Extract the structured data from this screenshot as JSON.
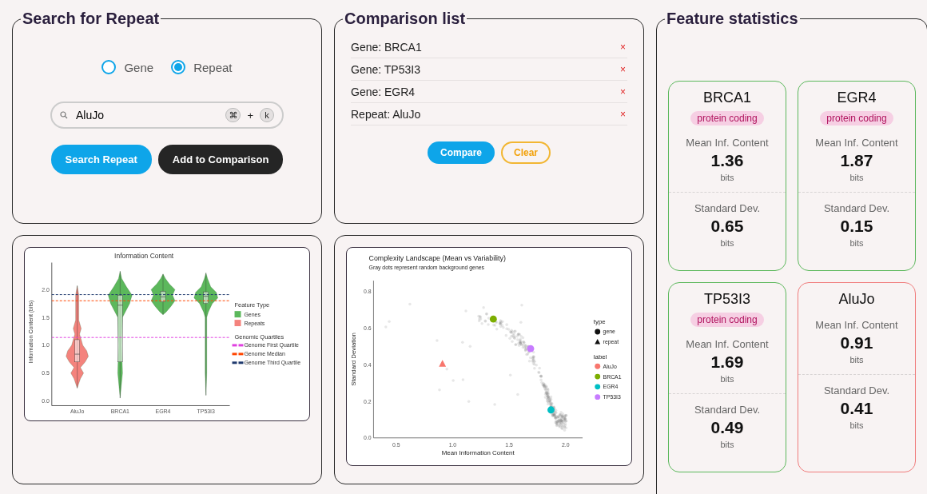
{
  "search_panel": {
    "title": "Search for Repeat",
    "modes": [
      {
        "label": "Gene",
        "selected": false
      },
      {
        "label": "Repeat",
        "selected": true
      }
    ],
    "search": {
      "value": "AluJo",
      "keys": [
        "⌘",
        "+",
        "k"
      ]
    },
    "buttons": [
      {
        "label": "Search Repeat",
        "kind": "primary"
      },
      {
        "label": "Add to Comparison",
        "kind": "dark"
      }
    ]
  },
  "comparison_panel": {
    "title": "Comparison list",
    "items": [
      {
        "label": "Gene: BRCA1",
        "remove": "×"
      },
      {
        "label": "Gene: TP53I3",
        "remove": "×"
      },
      {
        "label": "Gene: EGR4",
        "remove": "×"
      },
      {
        "label": "Repeat: AluJo",
        "remove": "×"
      }
    ],
    "buttons": [
      {
        "label": "Compare",
        "kind": "primary"
      },
      {
        "label": "Clear",
        "kind": "outline"
      }
    ]
  },
  "violin_chart": {
    "title": "Information Content",
    "ylabel": "Information Content (bits)",
    "yticks": [
      "2.0",
      "1.5",
      "1.0",
      "0.5",
      "0.0"
    ],
    "categories": [
      {
        "label": "AluJo",
        "color": "#f4837d"
      },
      {
        "label": "BRCA1",
        "color": "#5cb85c"
      },
      {
        "label": "EGR4",
        "color": "#5cb85c"
      },
      {
        "label": "TP53I3",
        "color": "#5cb85c"
      }
    ],
    "feature_title": "Feature Type",
    "features": [
      {
        "label": "Genes",
        "color": "#5cb85c"
      },
      {
        "label": "Repeats",
        "color": "#f4837d"
      }
    ],
    "quartile_title": "Genomic Quartiles",
    "quartiles": [
      {
        "label": "Genome First Quartile",
        "color": "#e040e0"
      },
      {
        "label": "Genome Median",
        "color": "#ff4500"
      },
      {
        "label": "Genome Third Quartile",
        "color": "#1f3a6e"
      }
    ]
  },
  "scatter_chart": {
    "chart_data": {
      "type": "scatter",
      "title": "Complexity Landscape (Mean vs Variability)",
      "annotations": [
        "Gray dots represent random background genes"
      ],
      "xlabel": "Mean Information Content",
      "ylabel": "Standard Deviation",
      "xlim": [
        0.3,
        2.15
      ],
      "ylim": [
        0,
        0.86
      ],
      "xticks": [
        {
          "value": 0.5,
          "label": "0.5"
        },
        {
          "value": 1,
          "label": "1.0"
        },
        {
          "value": 1.5,
          "label": "1.5"
        },
        {
          "value": 2,
          "label": "2.0"
        }
      ],
      "yticks": [
        {
          "value": 0,
          "label": "0.0"
        },
        {
          "value": 0.2,
          "label": "0.2"
        },
        {
          "value": 0.4,
          "label": "0.4"
        },
        {
          "value": 0.6,
          "label": "0.6"
        },
        {
          "value": 0.8,
          "label": "0.8"
        }
      ],
      "x": [
        0.91,
        1.36,
        1.69,
        1.87
      ],
      "series": [
        {
          "name": "AluJo",
          "color": "#f8766d",
          "values": [
            0.405,
            null,
            null,
            null
          ]
        },
        {
          "name": "BRCA1",
          "color": "#7cae00",
          "values": [
            null,
            0.65,
            null,
            null
          ]
        },
        {
          "name": "EGR4",
          "color": "#00bfc4",
          "values": [
            null,
            null,
            null,
            0.153
          ]
        },
        {
          "name": "TP53I3",
          "color": "#c77cff",
          "values": [
            null,
            null,
            0.488,
            null
          ]
        }
      ],
      "legend": "right"
    },
    "points": [
      {
        "repeat": true
      },
      {
        "repeat": false
      },
      {
        "repeat": false
      },
      {
        "repeat": false
      }
    ],
    "legend": {
      "type_title": "type",
      "types": [
        {
          "label": "gene",
          "kind": "gene"
        },
        {
          "label": "repeat",
          "kind": "repeat"
        }
      ],
      "label_title": "label"
    }
  },
  "stats_panel": {
    "title": "Feature statistics",
    "cards": [
      {
        "name": "BRCA1",
        "kind": "gene",
        "badge": "protein coding",
        "mean_label": "Mean Inf. Content",
        "mean": "1.36",
        "mean_unit": "bits",
        "sd_label": "Standard Dev.",
        "sd": "0.65",
        "sd_unit": "bits"
      },
      {
        "name": "EGR4",
        "kind": "gene",
        "badge": "protein coding",
        "mean_label": "Mean Inf. Content",
        "mean": "1.87",
        "mean_unit": "bits",
        "sd_label": "Standard Dev.",
        "sd": "0.15",
        "sd_unit": "bits"
      },
      {
        "name": "TP53I3",
        "kind": "gene",
        "badge": "protein coding",
        "mean_label": "Mean Inf. Content",
        "mean": "1.69",
        "mean_unit": "bits",
        "sd_label": "Standard Dev.",
        "sd": "0.49",
        "sd_unit": "bits"
      },
      {
        "name": "AluJo",
        "kind": "repeat",
        "mean_label": "Mean Inf. Content",
        "mean": "0.91",
        "mean_unit": "bits",
        "sd_label": "Standard Dev.",
        "sd": "0.41",
        "sd_unit": "bits"
      }
    ]
  }
}
